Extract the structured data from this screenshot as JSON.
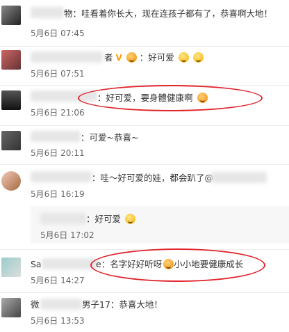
{
  "comments": [
    {
      "text": "物：哇看着你长大，现在连孩子都有了，恭喜啊大地！",
      "time": "5月6日 07:45"
    },
    {
      "name_tail": "者",
      "text": "：好可爱",
      "time": "5月6日 07:51"
    },
    {
      "text": "：好可爱，要身體健康啊",
      "time": "5月6日 21:06"
    },
    {
      "text": "：可爱~恭喜~",
      "time": "5月6日 20:11"
    },
    {
      "text": "：哇～好可爱的娃，都会趴了@",
      "time": "5月6日 16:19"
    },
    {
      "text": "：好可爱",
      "time": "5月6日 17:02"
    },
    {
      "name_head": "Sa",
      "text": "e：名字好好听呀",
      "text2": "小小地要健康成长",
      "time": "5月6日 14:27"
    },
    {
      "name_head": "微",
      "text": "男子17：恭喜大地！",
      "time": "5月6日 13:53"
    }
  ],
  "colors": {
    "highlight": "#e0252b",
    "badge": "#f5a000"
  }
}
